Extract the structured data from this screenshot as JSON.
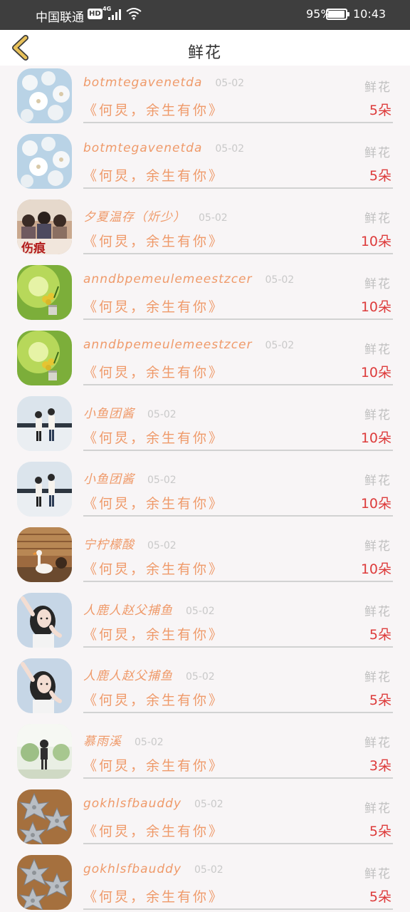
{
  "status_bar": {
    "carrier": "中国联通",
    "hd_badge": "HD",
    "network": "4G",
    "battery": "95%",
    "battery_level": 0.95,
    "time": "10:43"
  },
  "header": {
    "title": "鲜花",
    "back_icon": "chevron-left-icon"
  },
  "gifts": [
    {
      "sender": "botmtegavenetda",
      "date": "05-02",
      "category": "鲜花",
      "message": "《何炅，余生有你》",
      "quantity": "5朵",
      "avatar": "white-flowers"
    },
    {
      "sender": "botmtegavenetda",
      "date": "05-02",
      "category": "鲜花",
      "message": "《何炅，余生有你》",
      "quantity": "5朵",
      "avatar": "white-flowers"
    },
    {
      "sender": "夕夏温存（炘少）",
      "date": "05-02",
      "category": "鲜花",
      "message": "《何炅，余生有你》",
      "quantity": "10朵",
      "avatar": "drama-poster"
    },
    {
      "sender": "anndbpemeulemeestzcer",
      "date": "05-02",
      "category": "鲜花",
      "message": "《何炅，余生有你》",
      "quantity": "10朵",
      "avatar": "green-plant"
    },
    {
      "sender": "anndbpemeulemeestzcer",
      "date": "05-02",
      "category": "鲜花",
      "message": "《何炅，余生有你》",
      "quantity": "10朵",
      "avatar": "green-plant"
    },
    {
      "sender": "小鱼团酱",
      "date": "05-02",
      "category": "鲜花",
      "message": "《何炅，余生有你》",
      "quantity": "10朵",
      "avatar": "couple-illustration"
    },
    {
      "sender": "小鱼团酱",
      "date": "05-02",
      "category": "鲜花",
      "message": "《何炅，余生有你》",
      "quantity": "10朵",
      "avatar": "couple-illustration"
    },
    {
      "sender": "宁柠檬酸",
      "date": "05-02",
      "category": "鲜花",
      "message": "《何炅，余生有你》",
      "quantity": "10朵",
      "avatar": "goose-photo"
    },
    {
      "sender": "人鹿人赵父捕鱼",
      "date": "05-02",
      "category": "鲜花",
      "message": "《何炅，余生有你》",
      "quantity": "5朵",
      "avatar": "girl-portrait"
    },
    {
      "sender": "人鹿人赵父捕鱼",
      "date": "05-02",
      "category": "鲜花",
      "message": "《何炅，余生有你》",
      "quantity": "5朵",
      "avatar": "girl-portrait"
    },
    {
      "sender": "慕雨溪",
      "date": "05-02",
      "category": "鲜花",
      "message": "《何炅，余生有你》",
      "quantity": "3朵",
      "avatar": "garden-photo"
    },
    {
      "sender": "gokhlsfbauddy",
      "date": "05-02",
      "category": "鲜花",
      "message": "《何炅，余生有你》",
      "quantity": "5朵",
      "avatar": "paper-flowers"
    },
    {
      "sender": "gokhlsfbauddy",
      "date": "05-02",
      "category": "鲜花",
      "message": "《何炅，余生有你》",
      "quantity": "5朵",
      "avatar": "paper-flowers"
    }
  ],
  "colors": {
    "status_bar": "#3e3e3e",
    "sender_text": "#ef9a6a",
    "quantity_text": "#dd3b3b",
    "back_icon": "#e8c15a"
  }
}
